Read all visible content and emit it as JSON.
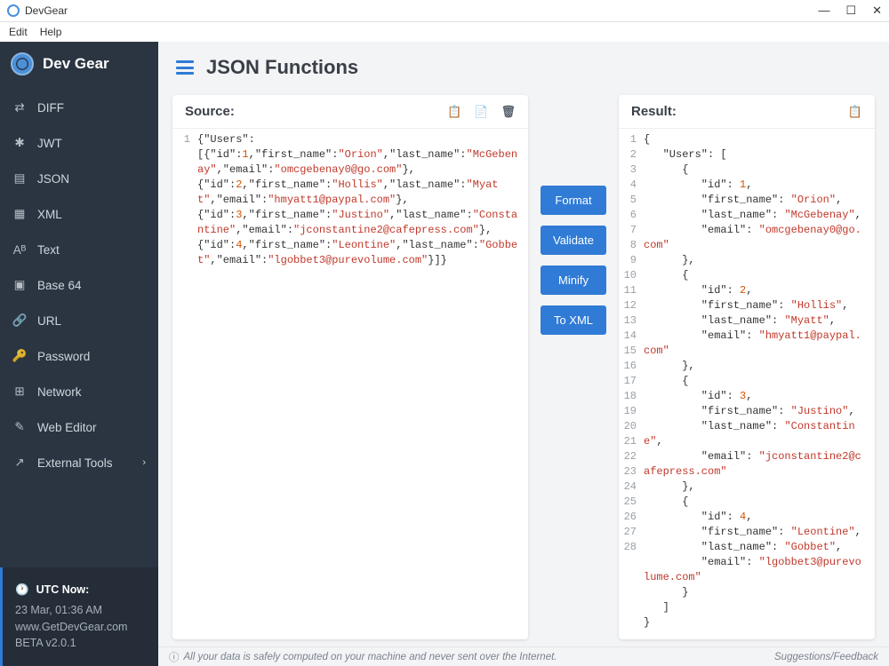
{
  "window": {
    "title": "DevGear",
    "minimize": "—",
    "maximize": "☐",
    "close": "✕"
  },
  "menubar": [
    "Edit",
    "Help"
  ],
  "sidebar": {
    "app_name": "Dev Gear",
    "items": [
      {
        "label": "DIFF",
        "icon": "diff-icon"
      },
      {
        "label": "JWT",
        "icon": "jwt-icon"
      },
      {
        "label": "JSON",
        "icon": "json-icon"
      },
      {
        "label": "XML",
        "icon": "xml-icon"
      },
      {
        "label": "Text",
        "icon": "text-icon"
      },
      {
        "label": "Base 64",
        "icon": "base64-icon"
      },
      {
        "label": "URL",
        "icon": "url-icon"
      },
      {
        "label": "Password",
        "icon": "password-icon"
      },
      {
        "label": "Network",
        "icon": "network-icon"
      },
      {
        "label": "Web Editor",
        "icon": "webeditor-icon"
      },
      {
        "label": "External Tools",
        "icon": "external-icon",
        "submenu": true
      }
    ],
    "utc": {
      "label": "UTC Now:",
      "time": "23 Mar, 01:36 AM",
      "site": "www.GetDevGear.com",
      "version": "BETA v2.0.1"
    }
  },
  "page": {
    "title": "JSON Functions"
  },
  "source": {
    "label": "Source:",
    "lines_raw": "{\"Users\":\n[{\"id\":1,\"first_name\":\"Orion\",\"last_name\":\"McGebenay\",\"email\":\"omcgebenay0@go.com\"},\n{\"id\":2,\"first_name\":\"Hollis\",\"last_name\":\"Myatt\",\"email\":\"hmyatt1@paypal.com\"},\n{\"id\":3,\"first_name\":\"Justino\",\"last_name\":\"Constantine\",\"email\":\"jconstantine2@cafepress.com\"},\n{\"id\":4,\"first_name\":\"Leontine\",\"last_name\":\"Gobbet\",\"email\":\"lgobbet3@purevolume.com\"}]}"
  },
  "actions": {
    "format": "Format",
    "validate": "Validate",
    "minify": "Minify",
    "toxml": "To XML"
  },
  "result": {
    "label": "Result:",
    "lines": [
      {
        "indent": 0,
        "text": "{"
      },
      {
        "indent": 1,
        "key": "Users",
        "suffix": ": ["
      },
      {
        "indent": 2,
        "text": "{"
      },
      {
        "indent": 3,
        "key": "id",
        "num": "1",
        "comma": true
      },
      {
        "indent": 3,
        "key": "first_name",
        "str": "Orion",
        "comma": true
      },
      {
        "indent": 3,
        "key": "last_name",
        "str": "McGebenay",
        "comma": true
      },
      {
        "indent": 3,
        "key": "email",
        "str": "omcgebenay0@go.com"
      },
      {
        "indent": 2,
        "text": "},"
      },
      {
        "indent": 2,
        "text": "{"
      },
      {
        "indent": 3,
        "key": "id",
        "num": "2",
        "comma": true
      },
      {
        "indent": 3,
        "key": "first_name",
        "str": "Hollis",
        "comma": true
      },
      {
        "indent": 3,
        "key": "last_name",
        "str": "Myatt",
        "comma": true
      },
      {
        "indent": 3,
        "key": "email",
        "str": "hmyatt1@paypal.com"
      },
      {
        "indent": 2,
        "text": "},"
      },
      {
        "indent": 2,
        "text": "{"
      },
      {
        "indent": 3,
        "key": "id",
        "num": "3",
        "comma": true
      },
      {
        "indent": 3,
        "key": "first_name",
        "str": "Justino",
        "comma": true
      },
      {
        "indent": 3,
        "key": "last_name",
        "str": "Constantine",
        "comma": true
      },
      {
        "indent": 3,
        "key": "email",
        "str": "jconstantine2@cafepress.com"
      },
      {
        "indent": 2,
        "text": "},"
      },
      {
        "indent": 2,
        "text": "{"
      },
      {
        "indent": 3,
        "key": "id",
        "num": "4",
        "comma": true
      },
      {
        "indent": 3,
        "key": "first_name",
        "str": "Leontine",
        "comma": true
      },
      {
        "indent": 3,
        "key": "last_name",
        "str": "Gobbet",
        "comma": true
      },
      {
        "indent": 3,
        "key": "email",
        "str": "lgobbet3@purevolume.com"
      },
      {
        "indent": 2,
        "text": "}"
      },
      {
        "indent": 1,
        "text": "]"
      },
      {
        "indent": 0,
        "text": "}"
      }
    ]
  },
  "footer": {
    "message": "All your data is safely computed on your machine and never sent over the Internet.",
    "feedback": "Suggestions/Feedback"
  },
  "icons": {
    "diff": "⇄",
    "jwt": "✱",
    "json": "▤",
    "xml": "▦",
    "text": "Aᴮ",
    "base64": "▣",
    "url": "🔗",
    "password": "🔑",
    "network": "⊞",
    "webeditor": "✎",
    "external": "↗",
    "clock": "🕐",
    "copy": "📋",
    "paste": "📄",
    "trash": "🗑"
  }
}
